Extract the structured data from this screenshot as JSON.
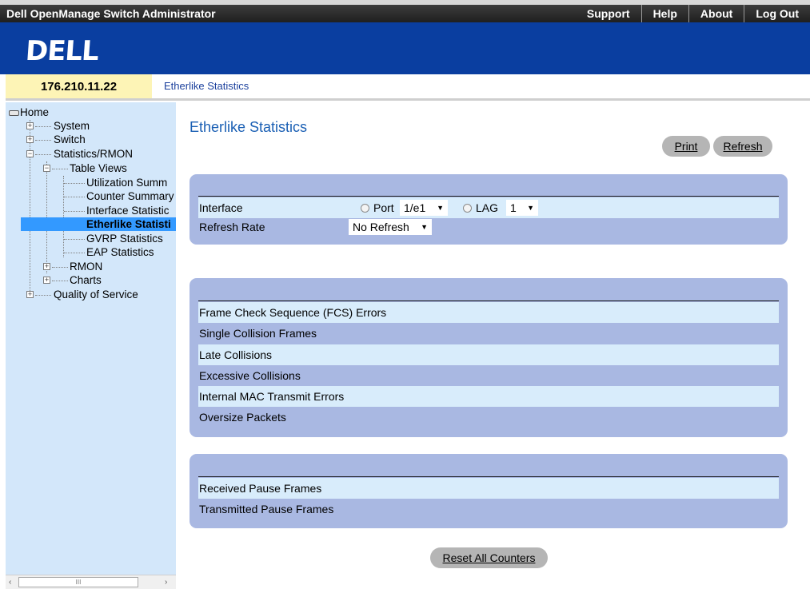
{
  "topbar": {
    "title": "Dell OpenManage Switch Administrator",
    "links": [
      "Support",
      "Help",
      "About",
      "Log Out"
    ]
  },
  "banner": {
    "logo": "DELL"
  },
  "header": {
    "ip": "176.210.11.22",
    "breadcrumb": "Etherlike Statistics"
  },
  "tree": {
    "home": "Home",
    "system": "System",
    "switch": "Switch",
    "stats": "Statistics/RMON",
    "table_views": "Table Views",
    "utilization": "Utilization Summ",
    "counter": "Counter Summary",
    "interface": "Interface Statistic",
    "etherlike": "Etherlike Statisti",
    "gvrp": "GVRP Statistics",
    "eap": "EAP Statistics",
    "rmon": "RMON",
    "charts": "Charts",
    "qos": "Quality of Service"
  },
  "scrollbar": {
    "left": "‹",
    "right": "›",
    "thumb": "III"
  },
  "main": {
    "title": "Etherlike Statistics",
    "print_label": "Print",
    "refresh_label": "Refresh",
    "reset_label": "Reset All Counters"
  },
  "form": {
    "interface_label": "Interface",
    "port_label": "Port",
    "port_value": "1/e1",
    "lag_label": "LAG",
    "lag_value": "1",
    "refresh_rate_label": "Refresh Rate",
    "refresh_rate_value": "No Refresh"
  },
  "errors": {
    "fcs": "Frame Check Sequence (FCS) Errors",
    "single": "Single Collision Frames",
    "late": "Late Collisions",
    "excessive": "Excessive Collisions",
    "mac": "Internal MAC Transmit Errors",
    "oversize": "Oversize Packets"
  },
  "pause": {
    "received": "Received Pause Frames",
    "transmitted": "Transmitted Pause Frames"
  },
  "colors": {
    "banner": "#0a3ea0",
    "tree_bg": "#d3e7fa",
    "selected": "#3399ff",
    "panel": "#a9b8e2",
    "row_light": "#d8ecfb",
    "title": "#1a5fb4"
  }
}
